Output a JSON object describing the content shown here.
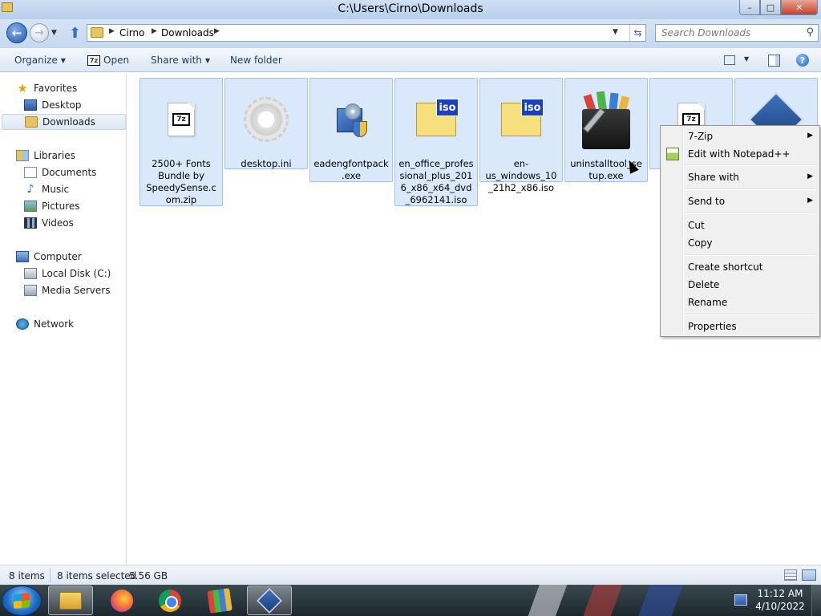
{
  "window": {
    "title": "C:\\Users\\Cirno\\Downloads"
  },
  "caption_buttons": {
    "minimize": "–",
    "maximize": "□",
    "close": "✕"
  },
  "address": {
    "crumbs": [
      "Cirno",
      "Downloads"
    ],
    "search_placeholder": "Search Downloads"
  },
  "toolbar": {
    "organize": "Organize",
    "open": "Open",
    "seven_zip_badge": "7z",
    "share_with": "Share with",
    "new_folder": "New folder"
  },
  "nav": {
    "favorites": "Favorites",
    "desktop": "Desktop",
    "downloads": "Downloads",
    "libraries": "Libraries",
    "documents": "Documents",
    "music": "Music",
    "pictures": "Pictures",
    "videos": "Videos",
    "computer": "Computer",
    "local_disk": "Local Disk (C:)",
    "media_servers": "Media Servers",
    "network": "Network"
  },
  "files": [
    {
      "name": "2500+ Fonts Bundle by SpeedySense.com.zip",
      "icon": "7z-archive-icon",
      "badge": "7z"
    },
    {
      "name": "desktop.ini",
      "icon": "settings-file-icon"
    },
    {
      "name": "eadengfontpack.exe",
      "icon": "installer-icon"
    },
    {
      "name": "en_office_professional_plus_2016_x86_x64_dvd_6962141.iso",
      "icon": "iso-icon",
      "badge": "iso"
    },
    {
      "name": "en-us_windows_10_21h2_x86.iso",
      "icon": "iso-icon",
      "badge": "iso"
    },
    {
      "name": "uninstalltool_setup.exe",
      "icon": "uninstall-tool-icon"
    },
    {
      "name": "",
      "icon": "7z-archive-icon",
      "badge": "7z"
    },
    {
      "name": "",
      "icon": "virtualbox-icon"
    }
  ],
  "context_menu": {
    "seven_zip": "7-Zip",
    "edit_notepad": "Edit with Notepad++",
    "share_with": "Share with",
    "send_to": "Send to",
    "cut": "Cut",
    "copy": "Copy",
    "create_shortcut": "Create shortcut",
    "delete": "Delete",
    "rename": "Rename",
    "properties": "Properties"
  },
  "status": {
    "item_count": "8 items",
    "selected": "8 items selected",
    "size": "5.56 GB"
  },
  "taskbar": {
    "time": "11:12 AM",
    "date": "4/10/2022"
  },
  "colors": {
    "selection_fill": "#d9e9fb",
    "selection_border": "#9fc3ee",
    "taskbar": "#2b393f",
    "titlebar": "#c5d9f1"
  }
}
